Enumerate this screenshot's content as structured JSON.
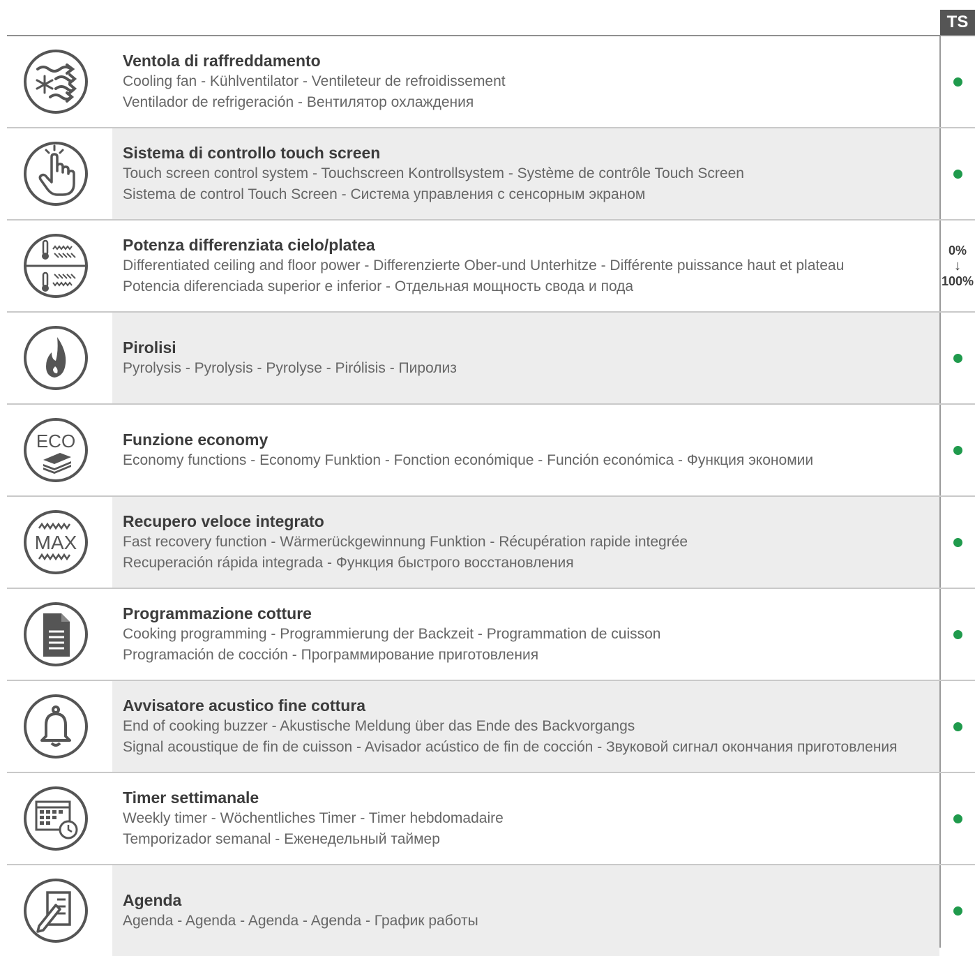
{
  "header": {
    "column_label": "TS"
  },
  "colors": {
    "dot": "#1f9a4c",
    "icon": "#555555",
    "shade": "#ededed"
  },
  "rows": [
    {
      "icon": "cooling-fan-icon",
      "title": "Ventola di raffreddamento",
      "lines": [
        "Cooling fan - Kühlventilator - Ventileteur de refroidissement",
        "Ventilador de refrigeración - Вентилятор охлаждения"
      ],
      "shaded": false,
      "mark": "dot"
    },
    {
      "icon": "touch-screen-icon",
      "title": "Sistema di controllo touch screen",
      "lines": [
        "Touch screen control system - Touchscreen Kontrollsystem - Système de contrôle Touch Screen",
        "Sistema de control Touch Screen - Система управления с сенсорным экраном"
      ],
      "shaded": true,
      "mark": "dot"
    },
    {
      "icon": "ceiling-floor-power-icon",
      "title": "Potenza differenziata cielo/platea",
      "lines": [
        "Differentiated ceiling and floor power - Differenzierte Ober-und Unterhitze - Différente puissance haut et plateau",
        "Potencia diferenciada superior e inferior - Отдельная мощность свода и пода"
      ],
      "shaded": false,
      "mark": "range",
      "range": {
        "from": "0%",
        "arrow": "↓",
        "to": "100%"
      }
    },
    {
      "icon": "pyrolysis-flame-icon",
      "title": "Pirolisi",
      "lines": [
        "Pyrolysis - Pyrolysis - Pyrolyse - Pirólisis - Пиролиз"
      ],
      "shaded": true,
      "mark": "dot"
    },
    {
      "icon": "eco-icon",
      "title": "Funzione economy",
      "lines": [
        "Economy functions - Economy Funktion - Fonction económique - Función económica - Функция экономии"
      ],
      "shaded": false,
      "mark": "dot"
    },
    {
      "icon": "max-recovery-icon",
      "title": "Recupero veloce integrato",
      "lines": [
        "Fast recovery function - Wärmerückgewinnung Funktion - Récupération rapide integrée",
        "Recuperación rápida integrada - Функция быстрого восстановления"
      ],
      "shaded": true,
      "mark": "dot"
    },
    {
      "icon": "program-document-icon",
      "title": "Programmazione cotture",
      "lines": [
        "Cooking programming - Programmierung der Backzeit - Programmation de cuisson",
        "Programación de cocción - Программирование приготовления"
      ],
      "shaded": false,
      "mark": "dot"
    },
    {
      "icon": "bell-icon",
      "title": "Avvisatore acustico fine cottura",
      "lines": [
        "End of cooking buzzer - Akustische Meldung über das Ende des Backvorgangs",
        "Signal acoustique de fin de cuisson - Avisador acústico de fin de cocción - Звуковой сигнал окончания приготовления"
      ],
      "shaded": true,
      "mark": "dot"
    },
    {
      "icon": "weekly-calendar-icon",
      "title": "Timer settimanale",
      "lines": [
        "Weekly timer - Wöchentliches Timer - Timer hebdomadaire",
        "Temporizador semanal - Еженедельный таймер"
      ],
      "shaded": false,
      "mark": "dot"
    },
    {
      "icon": "agenda-icon",
      "title": "Agenda",
      "lines": [
        "Agenda - Agenda - Agenda - Agenda - График работы"
      ],
      "shaded": true,
      "mark": "dot"
    }
  ]
}
